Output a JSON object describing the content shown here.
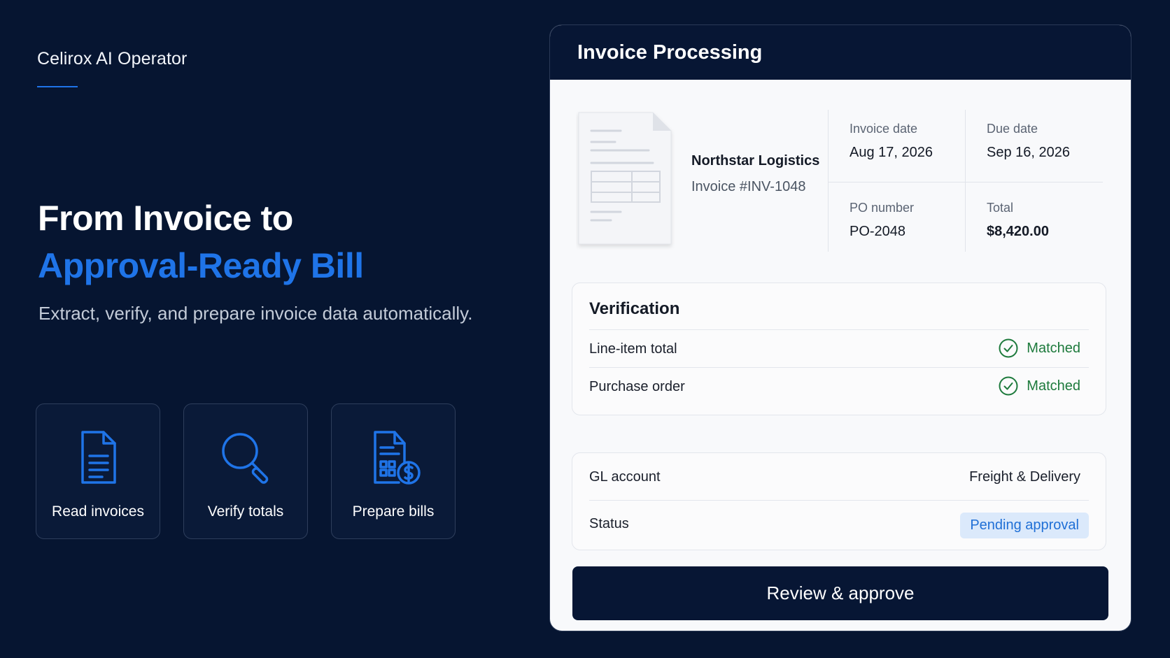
{
  "brand": {
    "name": "Celirox AI Operator"
  },
  "hero": {
    "line1": "From Invoice to",
    "line2": "Approval-Ready Bill",
    "subtitle": "Extract, verify, and prepare invoice data automatically."
  },
  "features": [
    {
      "label": "Read invoices",
      "icon": "document-icon"
    },
    {
      "label": "Verify totals",
      "icon": "magnifier-icon"
    },
    {
      "label": "Prepare bills",
      "icon": "invoice-dollar-icon"
    }
  ],
  "panel": {
    "title": "Invoice Processing",
    "vendor": "Northstar Logistics",
    "invoice_number": "Invoice #INV-1048",
    "meta": {
      "invoice_date_label": "Invoice date",
      "invoice_date": "Aug 17, 2026",
      "due_date_label": "Due date",
      "due_date": "Sep 16, 2026",
      "po_label": "PO number",
      "po": "PO-2048",
      "total_label": "Total",
      "total": "$8,420.00"
    },
    "verification": {
      "title": "Verification",
      "rows": [
        {
          "label": "Line-item total",
          "status": "Matched"
        },
        {
          "label": "Purchase order",
          "status": "Matched"
        }
      ]
    },
    "gl": {
      "gl_label": "GL account",
      "gl_value": "Freight & Delivery",
      "status_label": "Status",
      "status_value": "Pending approval"
    },
    "approve_button": "Review & approve"
  },
  "colors": {
    "background": "#061531",
    "accent": "#1f74e8",
    "matched": "#1d7a3c",
    "badge_bg": "#dbe9fb"
  }
}
